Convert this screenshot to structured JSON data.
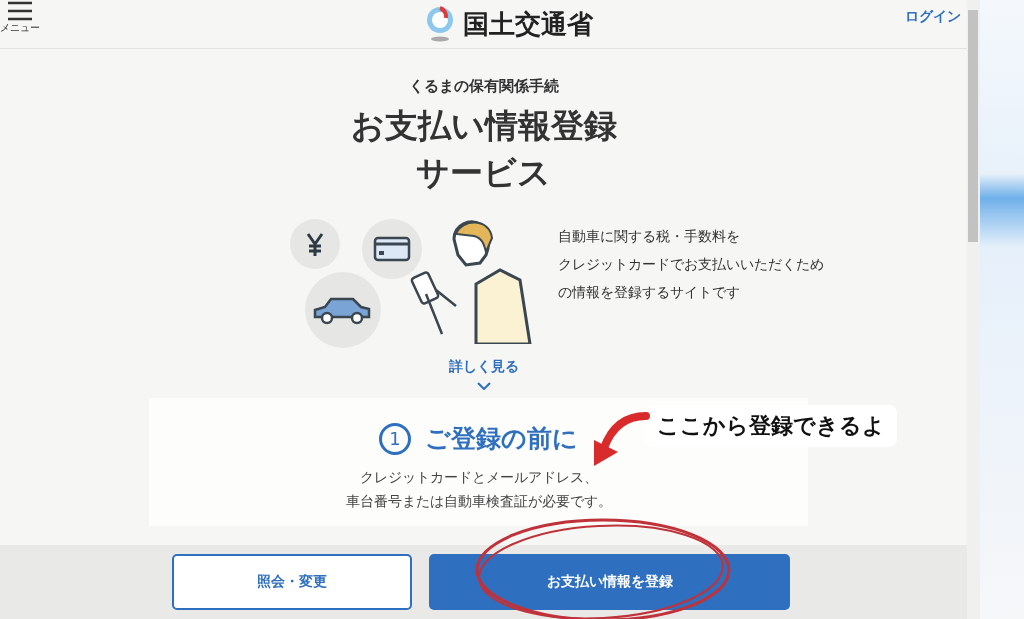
{
  "header": {
    "menu_label": "メニュー",
    "logo_text": "国土交通省",
    "login": "ログイン"
  },
  "hero": {
    "kicker": "くるまの保有関係手続",
    "title_lines": [
      "お支払い情報登録",
      "サービス"
    ],
    "description_lines": [
      "自動車に関する税・手数料を",
      "クレジットカードでお支払いいただくため",
      "の情報を登録するサイトです"
    ],
    "more_link": "詳しく見る"
  },
  "step": {
    "number": "1",
    "heading": "ご登録の前に",
    "text_lines": [
      "クレジットカードとメールアドレス、",
      "車台番号または自動車検査証が必要です。"
    ]
  },
  "bottom_buttons": [
    {
      "label": "照会・変更",
      "kind": "outline"
    },
    {
      "label": "お支払い情報を登録",
      "kind": "primary"
    }
  ],
  "annotation": {
    "text": "ここから登録できるよ"
  }
}
